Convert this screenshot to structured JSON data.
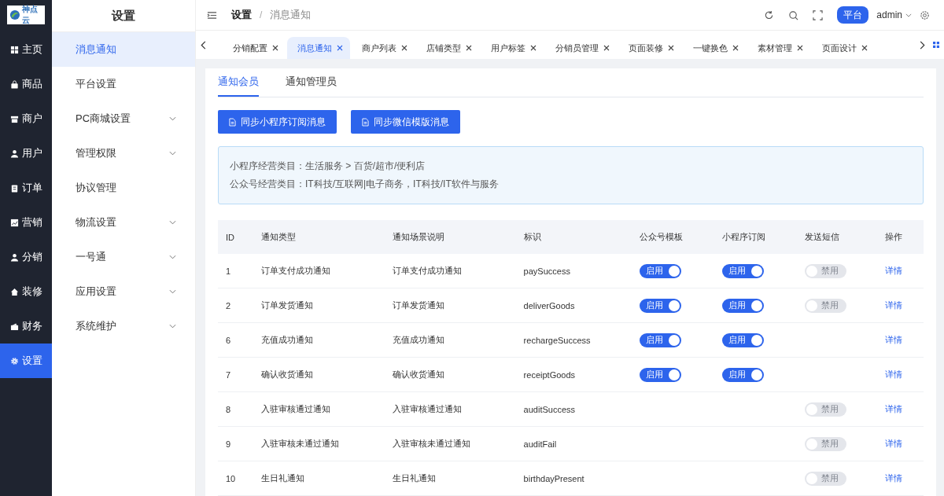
{
  "logo": {
    "text": "神点云"
  },
  "nav": [
    {
      "label": "主页",
      "selected": false
    },
    {
      "label": "商品",
      "selected": false
    },
    {
      "label": "商户",
      "selected": false
    },
    {
      "label": "用户",
      "selected": false
    },
    {
      "label": "订单",
      "selected": false
    },
    {
      "label": "营销",
      "selected": false
    },
    {
      "label": "分销",
      "selected": false
    },
    {
      "label": "装修",
      "selected": false
    },
    {
      "label": "财务",
      "selected": false
    },
    {
      "label": "设置",
      "selected": true
    }
  ],
  "submenu": {
    "title": "设置",
    "items": [
      {
        "label": "消息通知",
        "selected": true,
        "expandable": false
      },
      {
        "label": "平台设置",
        "selected": false,
        "expandable": false
      },
      {
        "label": "PC商城设置",
        "selected": false,
        "expandable": true
      },
      {
        "label": "管理权限",
        "selected": false,
        "expandable": true
      },
      {
        "label": "协议管理",
        "selected": false,
        "expandable": false
      },
      {
        "label": "物流设置",
        "selected": false,
        "expandable": true
      },
      {
        "label": "一号通",
        "selected": false,
        "expandable": true
      },
      {
        "label": "应用设置",
        "selected": false,
        "expandable": true
      },
      {
        "label": "系统维护",
        "selected": false,
        "expandable": true
      }
    ]
  },
  "header": {
    "breadcrumb": [
      "设置",
      "消息通知"
    ],
    "separator": "/",
    "platform": "平台",
    "user": "admin"
  },
  "tabs": [
    {
      "label": "分销配置",
      "selected": false
    },
    {
      "label": "消息通知",
      "selected": true
    },
    {
      "label": "商户列表",
      "selected": false
    },
    {
      "label": "店铺类型",
      "selected": false
    },
    {
      "label": "用户标签",
      "selected": false
    },
    {
      "label": "分销员管理",
      "selected": false
    },
    {
      "label": "页面装修",
      "selected": false
    },
    {
      "label": "一键换色",
      "selected": false
    },
    {
      "label": "素材管理",
      "selected": false
    },
    {
      "label": "页面设计",
      "selected": false
    }
  ],
  "subtabs": [
    {
      "label": "通知会员",
      "selected": true
    },
    {
      "label": "通知管理员",
      "selected": false
    }
  ],
  "buttons": [
    "同步小程序订阅消息",
    "同步微信模版消息"
  ],
  "info": [
    "小程序经营类目：生活服务 > 百货/超市/便利店",
    "公众号经营类目：IT科技/互联网|电子商务，IT科技/IT软件与服务"
  ],
  "table": {
    "columns": [
      "ID",
      "通知类型",
      "通知场景说明",
      "标识",
      "公众号模板",
      "小程序订阅",
      "发送短信",
      "操作"
    ],
    "rows": [
      {
        "id": "1",
        "type": "订单支付成功通知",
        "scene": "订单支付成功通知",
        "key": "paySuccess",
        "wechat": {
          "on": true,
          "label": "启用"
        },
        "mini": {
          "on": true,
          "label": "启用"
        },
        "sms": {
          "on": false,
          "label": "禁用"
        },
        "action": "详情"
      },
      {
        "id": "2",
        "type": "订单发货通知",
        "scene": "订单发货通知",
        "key": "deliverGoods",
        "wechat": {
          "on": true,
          "label": "启用"
        },
        "mini": {
          "on": true,
          "label": "启用"
        },
        "sms": {
          "on": false,
          "label": "禁用"
        },
        "action": "详情"
      },
      {
        "id": "6",
        "type": "充值成功通知",
        "scene": "充值成功通知",
        "key": "rechargeSuccess",
        "wechat": {
          "on": true,
          "label": "启用"
        },
        "mini": {
          "on": true,
          "label": "启用"
        },
        "action": "详情"
      },
      {
        "id": "7",
        "type": "确认收货通知",
        "scene": "确认收货通知",
        "key": "receiptGoods",
        "wechat": {
          "on": true,
          "label": "启用"
        },
        "mini": {
          "on": true,
          "label": "启用"
        },
        "action": "详情"
      },
      {
        "id": "8",
        "type": "入驻审核通过通知",
        "scene": "入驻审核通过通知",
        "key": "auditSuccess",
        "sms": {
          "on": false,
          "label": "禁用"
        },
        "action": "详情"
      },
      {
        "id": "9",
        "type": "入驻审核未通过通知",
        "scene": "入驻审核未通过通知",
        "key": "auditFail",
        "sms": {
          "on": false,
          "label": "禁用"
        },
        "action": "详情"
      },
      {
        "id": "10",
        "type": "生日礼通知",
        "scene": "生日礼通知",
        "key": "birthdayPresent",
        "sms": {
          "on": false,
          "label": "禁用"
        },
        "action": "详情"
      }
    ]
  }
}
